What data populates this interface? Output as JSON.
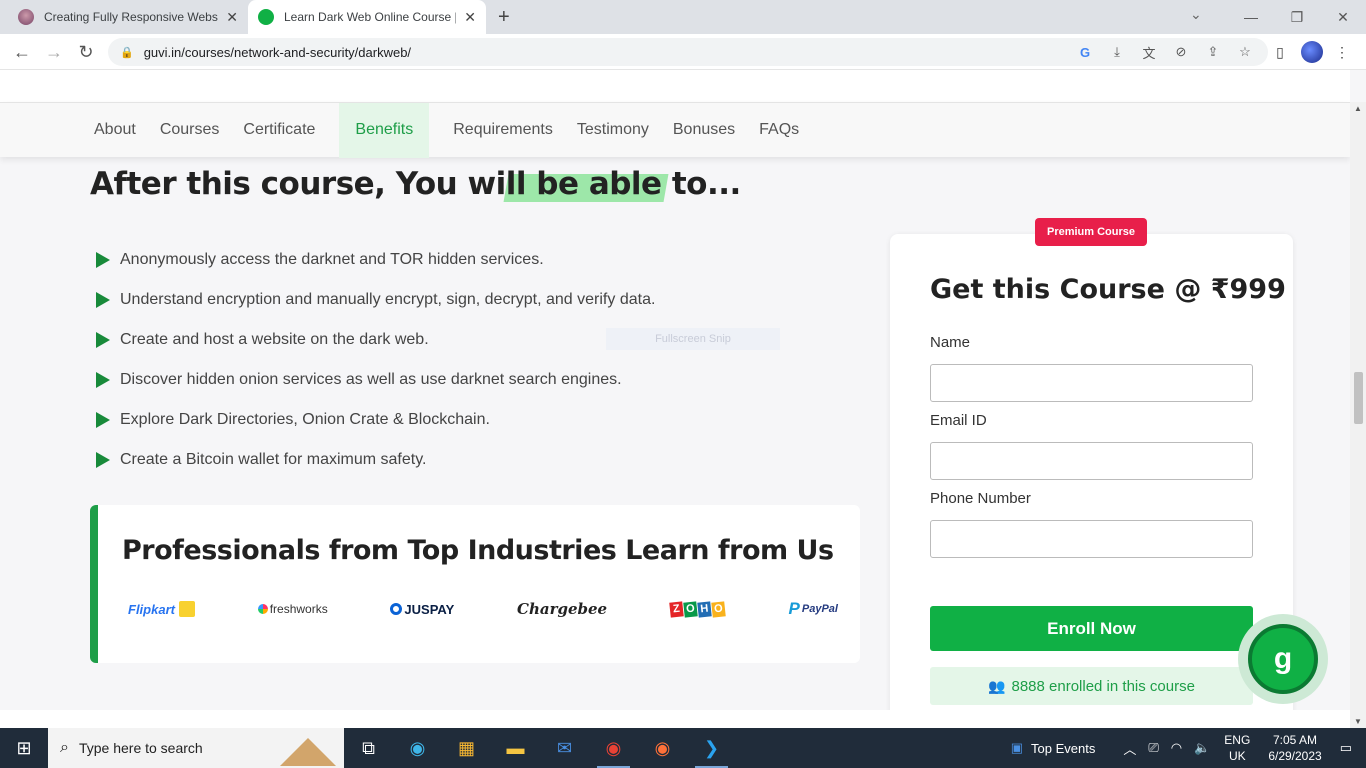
{
  "browser": {
    "tabs": [
      {
        "title": "Creating Fully Responsive Websit",
        "active": false
      },
      {
        "title": "Learn Dark Web Online Course |",
        "active": true
      }
    ],
    "url": "guvi.in/courses/network-and-security/darkweb/"
  },
  "subnav": {
    "items": [
      "About",
      "Courses",
      "Certificate",
      "Benefits",
      "Requirements",
      "Testimony",
      "Bonuses",
      "FAQs"
    ],
    "active": "Benefits"
  },
  "main": {
    "heading": "After this course, You will be able to...",
    "benefits": [
      "Anonymously access the darknet and TOR hidden services.",
      "Understand encryption and manually encrypt, sign, decrypt, and verify data.",
      "Create and host a website on the dark web.",
      "Discover hidden onion services as well as use darknet search engines.",
      "Explore Dark Directories, Onion Crate & Blockchain.",
      "Create a Bitcoin wallet for maximum safety."
    ],
    "ghost_text": "Fullscreen Snip"
  },
  "professionals": {
    "title": "Professionals from Top Industries Learn from Us",
    "logos": [
      "Flipkart",
      "freshworks",
      "JUSPAY",
      "Chargebee",
      "ZOHO",
      "PayPal"
    ]
  },
  "card": {
    "badge": "Premium Course",
    "title": "Get this Course @ ₹999",
    "name_label": "Name",
    "email_label": "Email ID",
    "phone_label": "Phone Number",
    "enroll_label": "Enroll Now",
    "enrolled_text": "8888 enrolled in this course"
  },
  "help": {
    "glyph": "g"
  },
  "taskbar": {
    "search_placeholder": "Type here to search",
    "news": "Top Events",
    "lang1": "ENG",
    "lang2": "UK",
    "time": "7:05 AM",
    "date": "6/29/2023"
  },
  "colors": {
    "accent": "#10b045",
    "badge": "#e81f4a",
    "highlight": "#9de7a9"
  }
}
